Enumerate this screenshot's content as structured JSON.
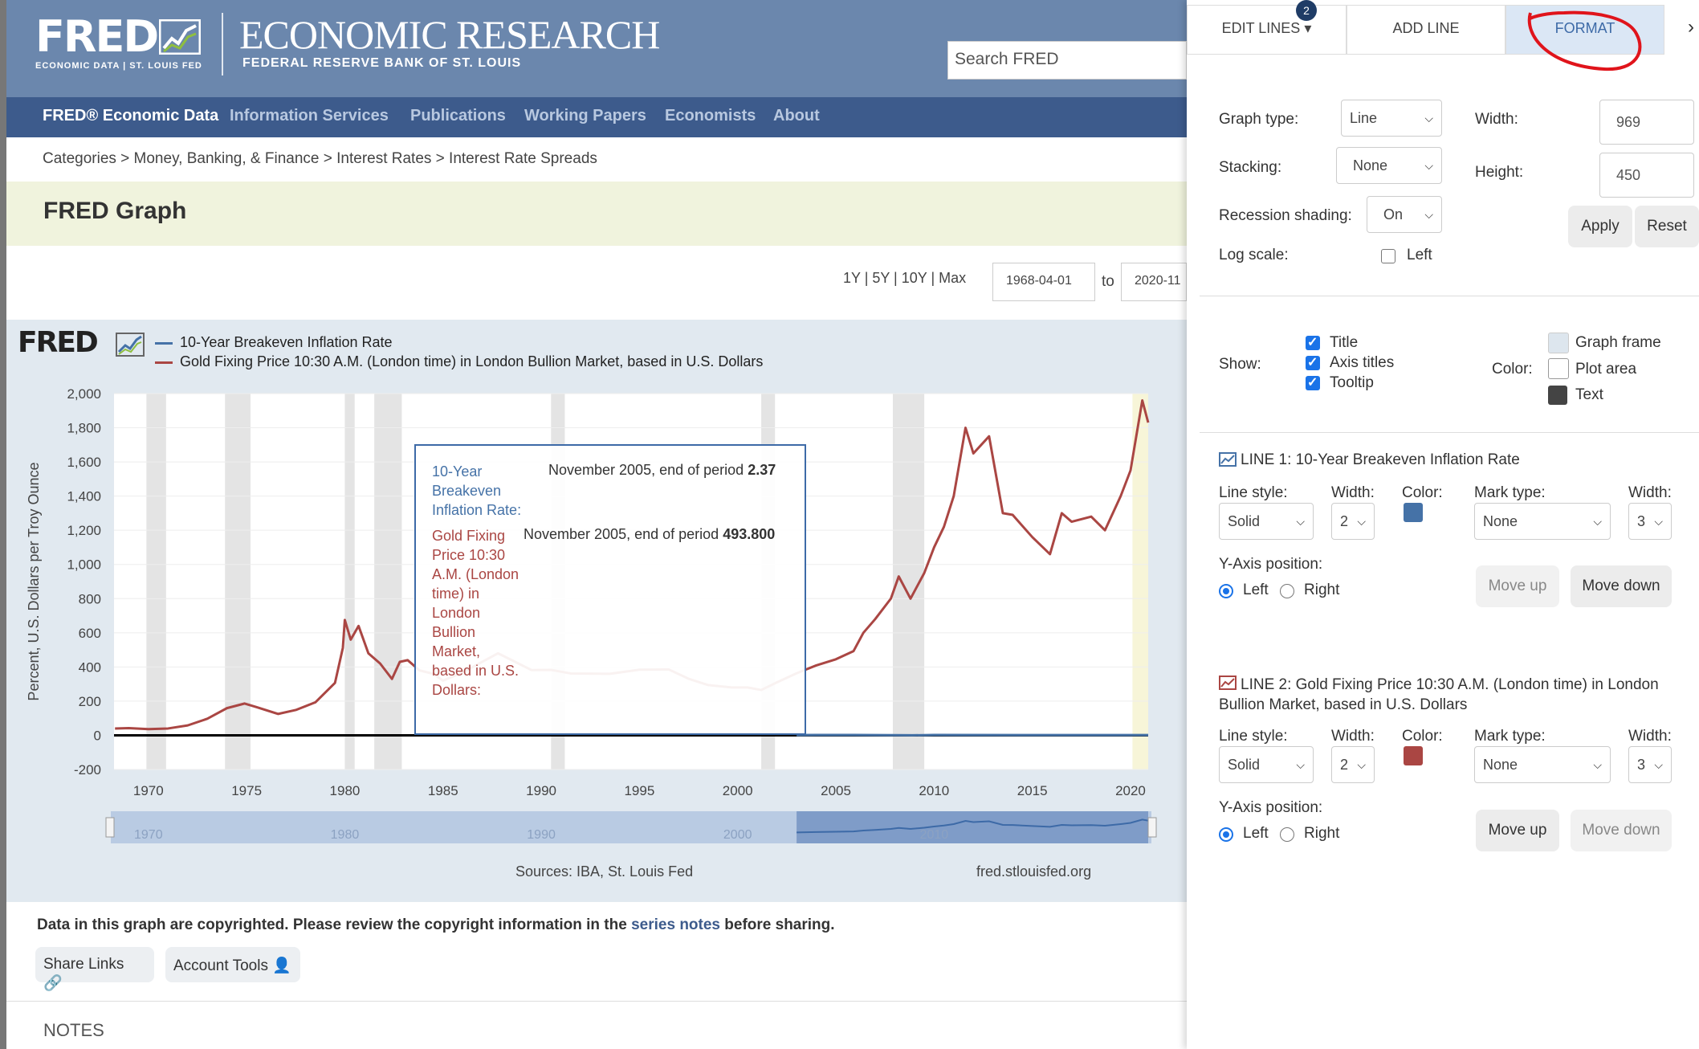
{
  "header": {
    "logo_main": "FRED",
    "logo_small": "ECONOMIC DATA | ST. LOUIS FED",
    "title": "ECONOMIC RESEARCH",
    "subtitle": "FEDERAL RESERVE BANK OF ST. LOUIS",
    "search_placeholder": "Search FRED"
  },
  "nav": [
    "FRED® Economic Data",
    "Information Services",
    "Publications",
    "Working Papers",
    "Economists",
    "About"
  ],
  "breadcrumb": "Categories > Money, Banking, & Finance > Interest Rates > Interest Rate Spreads",
  "page_title": "FRED Graph",
  "date_range": {
    "ranges": "1Y | 5Y | 10Y | Max",
    "from": "1968-04-01",
    "to_label": "to",
    "to": "2020-11"
  },
  "chart_data": {
    "type": "line",
    "logo": "FRED",
    "legend": [
      {
        "name": "10-Year Breakeven Inflation Rate",
        "color": "#4572a7"
      },
      {
        "name": "Gold Fixing Price 10:30 A.M. (London time) in London Bullion Market, based in U.S. Dollars",
        "color": "#aa4643"
      }
    ],
    "ylabel": "Percent, U.S. Dollars per Troy Ounce",
    "yticks": [
      "2,000",
      "1,800",
      "1,600",
      "1,400",
      "1,200",
      "1,000",
      "800",
      "600",
      "400",
      "200",
      "0",
      "-200"
    ],
    "xticks": [
      "1970",
      "1975",
      "1980",
      "1985",
      "1990",
      "1995",
      "2000",
      "2005",
      "2010",
      "2015",
      "2020"
    ],
    "ylim": [
      -200,
      2000
    ],
    "xlim": [
      1968.25,
      2020.9
    ],
    "navigator_ticks": [
      "1970",
      "1980",
      "1990",
      "2000",
      "2010"
    ],
    "recessions": [
      [
        1969.9,
        1970.9
      ],
      [
        1973.9,
        1975.2
      ],
      [
        1980.0,
        1980.5
      ],
      [
        1981.5,
        1982.9
      ],
      [
        1990.5,
        1991.2
      ],
      [
        2001.2,
        2001.9
      ],
      [
        2007.9,
        2009.5
      ],
      [
        2020.1,
        2020.9
      ]
    ],
    "series": [
      {
        "name": "Gold Fixing Price 10:30 A.M. (London time) in London Bullion Market, based in U.S. Dollars",
        "color": "#aa4643",
        "x": [
          1968.3,
          1969,
          1970,
          1971,
          1972,
          1973,
          1974,
          1974.9,
          1975.5,
          1976.6,
          1977.5,
          1978.5,
          1979.5,
          1979.9,
          1980.0,
          1980.3,
          1980.7,
          1981.2,
          1981.8,
          1982.4,
          1982.8,
          1983.2,
          1983.8,
          1984.5,
          1985.0,
          1986,
          1987.8,
          1988.5,
          1989.5,
          1990.5,
          1991.5,
          1993.5,
          1995,
          1996.5,
          1997.5,
          1998.5,
          1999.7,
          2000.5,
          2001.2,
          2002,
          2003,
          2004,
          2005,
          2005.9,
          2006.4,
          2007,
          2007.8,
          2008.2,
          2008.8,
          2009.5,
          2010,
          2010.5,
          2011,
          2011.6,
          2012,
          2012.8,
          2013.5,
          2014,
          2015,
          2015.9,
          2016.5,
          2017,
          2018,
          2018.7,
          2019.5,
          2020.0,
          2020.6,
          2020.9
        ],
        "values": [
          40,
          42,
          36,
          40,
          58,
          97,
          159,
          186,
          165,
          125,
          148,
          193,
          307,
          512,
          675,
          560,
          640,
          480,
          420,
          330,
          430,
          440,
          380,
          360,
          320,
          368,
          480,
          440,
          382,
          383,
          362,
          360,
          384,
          385,
          331,
          294,
          280,
          280,
          265,
          310,
          363,
          409,
          445,
          493,
          600,
          680,
          800,
          930,
          800,
          950,
          1100,
          1220,
          1400,
          1800,
          1650,
          1750,
          1300,
          1290,
          1160,
          1060,
          1300,
          1250,
          1280,
          1200,
          1400,
          1550,
          1960,
          1830
        ]
      },
      {
        "name": "10-Year Breakeven Inflation Rate",
        "color": "#4572a7",
        "x": [
          2003.0,
          2005.9,
          2008.9,
          2010,
          2015,
          2020.9
        ],
        "values": [
          1.6,
          2.37,
          0.1,
          2.2,
          1.6,
          1.7
        ]
      }
    ],
    "tooltip": {
      "line1_label": "10-Year Breakeven Inflation Rate:",
      "line1_value_prefix": "November 2005, end of period",
      "line1_value": "2.37",
      "line2_label": "Gold Fixing Price 10:30 A.M. (London time) in London Bullion Market, based in U.S. Dollars:",
      "line2_value_prefix": "November 2005, end of period",
      "line2_value": "493.800"
    },
    "sources": "Sources: IBA, St. Louis Fed",
    "site": "fred.stlouisfed.org"
  },
  "footer": {
    "copy_pre": "Data in this graph are copyrighted. Please review the copyright information in the",
    "copy_link": "series notes",
    "copy_post": "before sharing.",
    "share": "Share Links",
    "account": "Account Tools",
    "notes": "NOTES"
  },
  "panel": {
    "tabs": {
      "edit": "EDIT LINES",
      "edit_badge": "2",
      "add": "ADD LINE",
      "format": "FORMAT"
    },
    "graph_type_label": "Graph type:",
    "graph_type": "Line",
    "stacking_label": "Stacking:",
    "stacking": "None",
    "recession_label": "Recession shading:",
    "recession": "On",
    "log_label": "Log scale:",
    "log_left": "Left",
    "width_label": "Width:",
    "width": "969",
    "height_label": "Height:",
    "height": "450",
    "apply": "Apply",
    "reset": "Reset",
    "show_label": "Show:",
    "show_title": "Title",
    "show_axis": "Axis titles",
    "show_tooltip": "Tooltip",
    "color_label": "Color:",
    "graph_frame": "Graph frame",
    "plot_area": "Plot area",
    "text": "Text",
    "colors": {
      "graph_frame": "#dde6ee",
      "plot_area": "#ffffff",
      "text": "#444444",
      "line1": "#4572a7",
      "line2": "#aa4643"
    },
    "line1": {
      "title": "LINE 1: 10-Year Breakeven Inflation Rate",
      "style_label": "Line style:",
      "style": "Solid",
      "width_label": "Width:",
      "width": "2",
      "color_label": "Color:",
      "mark_label": "Mark type:",
      "mark": "None",
      "mwidth_label": "Width:",
      "mwidth": "3",
      "yaxis_label": "Y-Axis position:",
      "left": "Left",
      "right": "Right",
      "move_up": "Move up",
      "move_down": "Move down"
    },
    "line2": {
      "title": "LINE 2: Gold Fixing Price 10:30 A.M. (London time) in London Bullion Market, based in U.S. Dollars",
      "style_label": "Line style:",
      "style": "Solid",
      "width_label": "Width:",
      "width": "2",
      "color_label": "Color:",
      "mark_label": "Mark type:",
      "mark": "None",
      "mwidth_label": "Width:",
      "mwidth": "3",
      "yaxis_label": "Y-Axis position:",
      "left": "Left",
      "right": "Right",
      "move_up": "Move up",
      "move_down": "Move down"
    }
  }
}
